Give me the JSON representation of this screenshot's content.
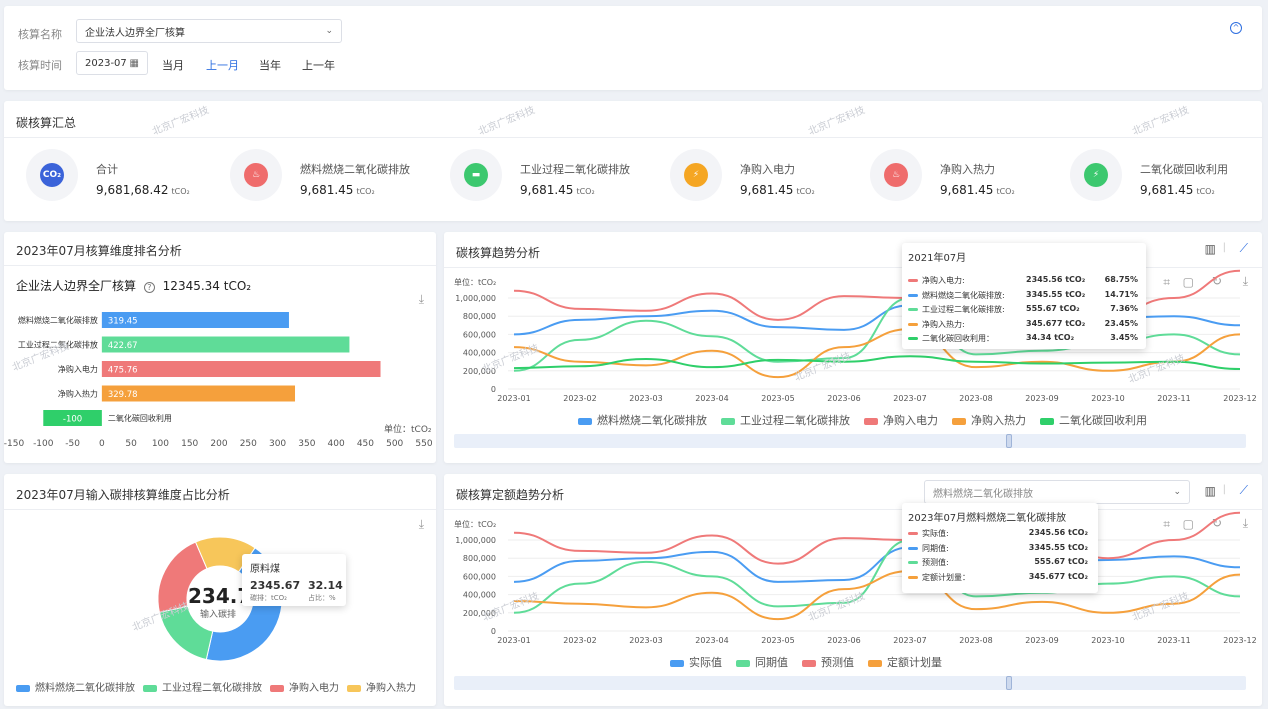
{
  "filter": {
    "name_label": "核算名称",
    "name_value": "企业法人边界全厂核算",
    "time_label": "核算时间",
    "time_value": "2023-07",
    "quick": [
      "当月",
      "上一月",
      "当年",
      "上一年"
    ],
    "active_quick": 1
  },
  "watermark": "北京广宏科技",
  "summary": {
    "title": "碳核算汇总",
    "items": [
      {
        "label": "合计",
        "value": "9,681,68.42",
        "unit": "tCO₂",
        "icon": "cloud-co2-icon",
        "color": "#3b63d9",
        "glyph": "CO₂"
      },
      {
        "label": "燃料燃烧二氧化碳排放",
        "value": "9,681.45",
        "unit": "tCO₂",
        "icon": "flame-icon",
        "color": "#ef6c6c",
        "glyph": "♨"
      },
      {
        "label": "工业过程二氧化碳排放",
        "value": "9,681.45",
        "unit": "tCO₂",
        "icon": "mine-cart-icon",
        "color": "#3cc86f",
        "glyph": "▬"
      },
      {
        "label": "净购入电力",
        "value": "9,681.45",
        "unit": "tCO₂",
        "icon": "power-plug-icon",
        "color": "#f5a623",
        "glyph": "⚡"
      },
      {
        "label": "净购入热力",
        "value": "9,681.45",
        "unit": "tCO₂",
        "icon": "heat-flame-icon",
        "color": "#ef6c6c",
        "glyph": "♨"
      },
      {
        "label": "二氧化碳回收利用",
        "value": "9,681.45",
        "unit": "tCO₂",
        "icon": "lightning-icon",
        "color": "#3cc86f",
        "glyph": "⚡"
      }
    ]
  },
  "rank": {
    "title": "2023年07月核算维度排名分析",
    "subtitle": "企业法人边界全厂核算",
    "subtitle_value": "12345.34 tCO₂",
    "unit_label": "单位：tCO₂",
    "chart_data": {
      "type": "bar",
      "orientation": "horizontal",
      "categories": [
        "燃料燃烧二氧化碳排放",
        "工业过程二氧化碳排放",
        "净购入电力",
        "净购入热力",
        "二氧化碳回收利用"
      ],
      "values": [
        319.45,
        422.67,
        475.76,
        329.78,
        -100
      ],
      "colors": [
        "#4a9cf2",
        "#5fdc98",
        "#ef7979",
        "#f5a03c",
        "#2fcf6a"
      ],
      "xlim": [
        -150,
        550
      ],
      "xticks": [
        -150,
        -100,
        -50,
        0,
        50,
        100,
        150,
        200,
        250,
        300,
        350,
        400,
        450,
        500,
        550
      ]
    }
  },
  "donut": {
    "title": "2023年07月输入碳排核算维度占比分析",
    "center_value": "234.78",
    "center_label": "输入碳排",
    "tooltip": {
      "title": "原料煤",
      "value1": "2345.67",
      "label1": "碳排：tCO₂",
      "value2": "32.14",
      "label2": "占比：%"
    },
    "chart_data": {
      "type": "pie",
      "labels": [
        "燃料燃烧二氧化碳排放",
        "工业过程二氧化碳排放",
        "净购入电力",
        "净购入热力"
      ],
      "colors": [
        "#4a9cf2",
        "#5fdc98",
        "#ef7979",
        "#f7c65a"
      ],
      "values": [
        44,
        18,
        22,
        16
      ]
    }
  },
  "trend": {
    "title": "碳核算趋势分析",
    "unit_label": "单位：tCO₂",
    "tooltip": {
      "title": "2021年07月",
      "rows": [
        {
          "name": "净购入电力:",
          "value": "2345.56 tCO₂",
          "pct": "68.75%",
          "color": "#ef7979"
        },
        {
          "name": "燃料燃烧二氧化碳排放:",
          "value": "3345.55 tCO₂",
          "pct": "14.71%",
          "color": "#4a9cf2"
        },
        {
          "name": "工业过程二氧化碳排放:",
          "value": "555.67 tCO₂",
          "pct": "7.36%",
          "color": "#5fdc98"
        },
        {
          "name": "净购入热力:",
          "value": "345.677 tCO₂",
          "pct": "23.45%",
          "color": "#f5a03c"
        },
        {
          "name": "二氧化碳回收利用：",
          "value": "34.34 tCO₂",
          "pct": "3.45%",
          "color": "#2fcf6a"
        }
      ]
    },
    "chart_data": {
      "type": "line",
      "x": [
        "2023-01",
        "2023-02",
        "2023-03",
        "2023-04",
        "2023-05",
        "2023-06",
        "2023-07",
        "2023-08",
        "2023-09",
        "2023-10",
        "2023-11",
        "2023-12"
      ],
      "ylim": [
        0,
        1000000
      ],
      "yticks": [
        "0",
        "200,000",
        "400,000",
        "600,000",
        "800,000",
        "1,000,000"
      ],
      "series": [
        {
          "name": "燃料燃烧二氧化碳排放",
          "color": "#4a9cf2",
          "values": [
            600000,
            760000,
            800000,
            860000,
            680000,
            650000,
            920000,
            700000,
            740000,
            780000,
            800000,
            700000
          ]
        },
        {
          "name": "工业过程二氧化碳排放",
          "color": "#5fdc98",
          "values": [
            200000,
            540000,
            750000,
            580000,
            300000,
            340000,
            1000000,
            380000,
            420000,
            500000,
            600000,
            380000
          ]
        },
        {
          "name": "净购入电力",
          "color": "#ef7979",
          "values": [
            1080000,
            880000,
            860000,
            1050000,
            760000,
            1020000,
            1000000,
            1080000,
            1000000,
            820000,
            1000000,
            1300000
          ]
        },
        {
          "name": "净购入热力",
          "color": "#f5a03c",
          "values": [
            460000,
            300000,
            260000,
            420000,
            130000,
            460000,
            660000,
            240000,
            300000,
            200000,
            300000,
            600000
          ]
        },
        {
          "name": "二氧化碳回收利用",
          "color": "#2fcf6a",
          "values": [
            230000,
            250000,
            330000,
            240000,
            320000,
            300000,
            360000,
            300000,
            280000,
            290000,
            300000,
            220000
          ]
        }
      ]
    }
  },
  "quota": {
    "title": "碳核算定额趋势分析",
    "select_value": "燃料燃烧二氧化碳排放",
    "unit_label": "单位：tCO₂",
    "tooltip": {
      "title": "2023年07月燃料燃烧二氧化碳排放",
      "rows": [
        {
          "name": "实际值:",
          "value": "2345.56 tCO₂",
          "color": "#ef7979"
        },
        {
          "name": "同期值:",
          "value": "3345.55 tCO₂",
          "color": "#4a9cf2"
        },
        {
          "name": "预测值:",
          "value": "555.67 tCO₂",
          "color": "#5fdc98"
        },
        {
          "name": "定额计划量：",
          "value": "345.677 tCO₂",
          "color": "#f5a03c"
        }
      ]
    },
    "chart_data": {
      "type": "line",
      "x": [
        "2023-01",
        "2023-02",
        "2023-03",
        "2023-04",
        "2023-05",
        "2023-06",
        "2023-07",
        "2023-08",
        "2023-09",
        "2023-10",
        "2023-11",
        "2023-12"
      ],
      "ylim": [
        0,
        1000000
      ],
      "yticks": [
        "0",
        "200,000",
        "400,000",
        "600,000",
        "800,000",
        "1,000,000"
      ],
      "series": [
        {
          "name": "实际值",
          "color": "#4a9cf2",
          "values": [
            540000,
            770000,
            800000,
            870000,
            540000,
            560000,
            920000,
            700000,
            760000,
            780000,
            820000,
            700000
          ]
        },
        {
          "name": "同期值",
          "color": "#5fdc98",
          "values": [
            200000,
            520000,
            760000,
            600000,
            270000,
            310000,
            1000000,
            380000,
            420000,
            520000,
            600000,
            380000
          ]
        },
        {
          "name": "预测值",
          "color": "#ef7979",
          "values": [
            1080000,
            880000,
            860000,
            1050000,
            740000,
            1020000,
            1000000,
            1080000,
            1000000,
            800000,
            1000000,
            1300000
          ]
        },
        {
          "name": "定额计划量",
          "color": "#f5a03c",
          "values": [
            330000,
            300000,
            260000,
            420000,
            130000,
            460000,
            660000,
            240000,
            320000,
            200000,
            300000,
            620000
          ]
        }
      ]
    }
  }
}
